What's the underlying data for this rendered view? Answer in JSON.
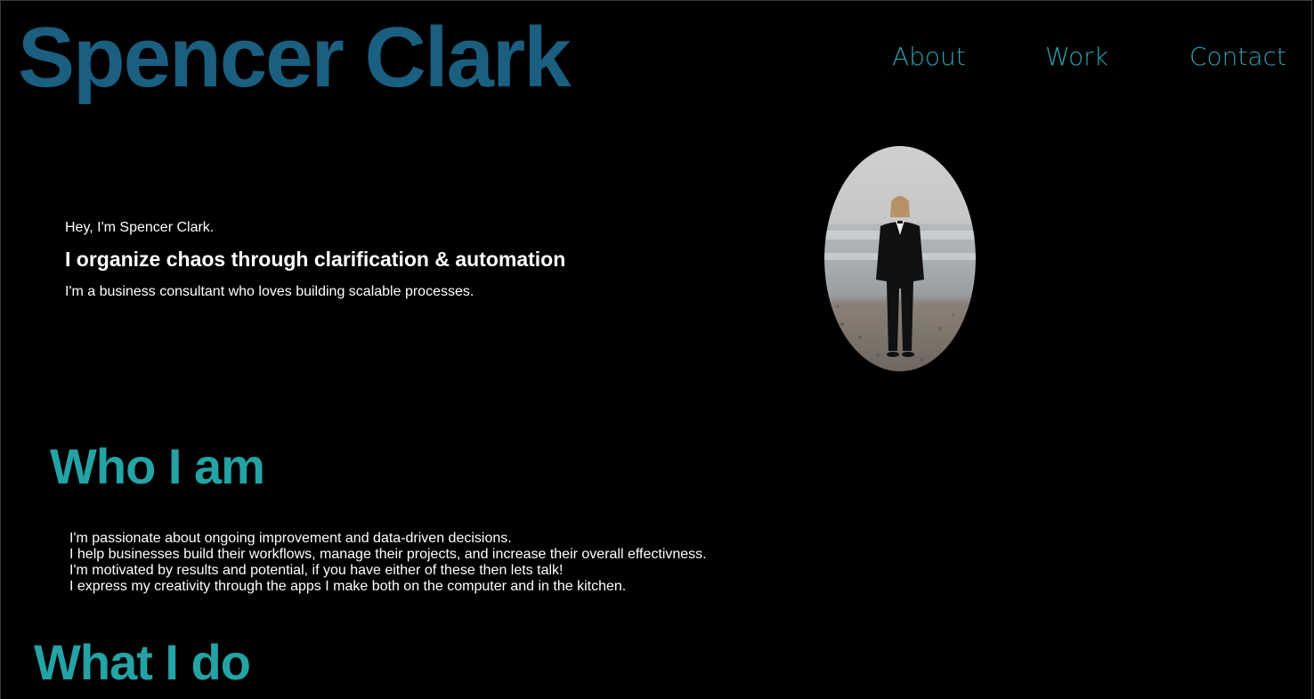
{
  "header": {
    "site_title": "Spencer Clark",
    "nav": [
      {
        "label": "About"
      },
      {
        "label": "Work"
      },
      {
        "label": "Contact"
      }
    ]
  },
  "hero": {
    "intro": "Hey, I'm Spencer Clark.",
    "headline": "I organize chaos through clarification & automation",
    "subtitle": "I'm a business consultant who loves building scalable processes."
  },
  "who": {
    "heading": "Who I am",
    "lines": [
      "I'm passionate about ongoing improvement and data-driven decisions.",
      "I help businesses build their workflows, manage their projects, and increase their overall effectivness.",
      "I'm motivated by results and potential, if you have either of these then lets talk!",
      "I express my creativity through the apps I make both on the computer and in the kitchen."
    ]
  },
  "what": {
    "heading": "What I do"
  },
  "colors": {
    "title": "#1a5f80",
    "nav": "#2aa0aa",
    "section_heading": "#24a3a5",
    "background": "#000000",
    "text": "#ffffff"
  },
  "icons": {
    "portrait": "portrait-photo"
  }
}
